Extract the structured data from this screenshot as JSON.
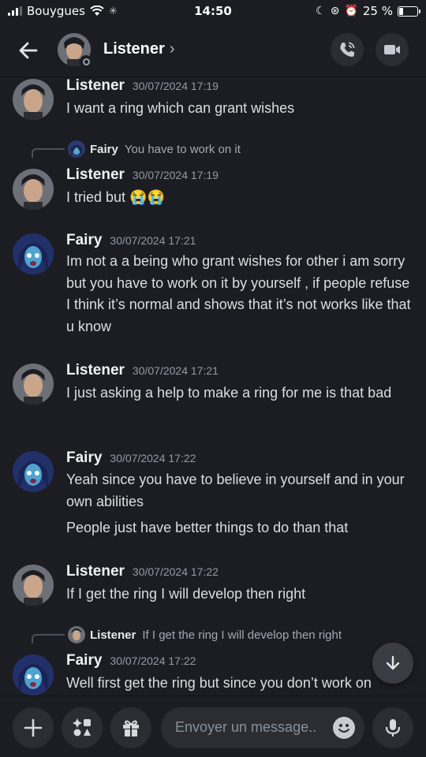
{
  "status_bar": {
    "carrier": "Bouygues",
    "time": "14:50",
    "battery_text": "25 %",
    "battery_level": 0.25
  },
  "header": {
    "title": "Listener",
    "chevron": "›",
    "icons": {
      "back": "arrow-left-icon",
      "call": "phone-call-icon",
      "video": "video-camera-icon"
    }
  },
  "messages": [
    {
      "author": "Listener",
      "timestamp": "30/07/2024 17:19",
      "lines": [
        "I want a ring which can grant wishes"
      ]
    },
    {
      "reply": {
        "author": "Fairy",
        "text": "You have to work on it"
      },
      "author": "Listener",
      "timestamp": "30/07/2024 17:19",
      "lines": [
        "I tried but 😭😭"
      ]
    },
    {
      "author": "Fairy",
      "timestamp": "30/07/2024 17:21",
      "lines": [
        "Im not a a being who grant wishes for other i am sorry but you have to work on it by yourself , if people refuse I think it’s normal and shows that it’s not works like that u know"
      ]
    },
    {
      "author": "Listener",
      "timestamp": "30/07/2024 17:21",
      "lines": [
        "I just asking a help to make a ring for me is that bad"
      ]
    },
    {
      "author": "Fairy",
      "timestamp": "30/07/2024 17:22",
      "lines": [
        "Yeah since you have to believe in yourself and in your own abilities",
        "People just have better things to do than that"
      ]
    },
    {
      "author": "Listener",
      "timestamp": "30/07/2024 17:22",
      "lines": [
        "If I get the ring I will develop then right"
      ]
    },
    {
      "reply": {
        "author": "Listener",
        "text": "If I get the ring I will develop then right"
      },
      "author": "Fairy",
      "timestamp": "30/07/2024 17:22",
      "lines": [
        "Well first get the ring but since you don’t work on"
      ]
    }
  ],
  "composer": {
    "placeholder": "Envoyer un message..",
    "icons": {
      "add": "plus-icon",
      "apps": "apps-icon",
      "gift": "gift-icon",
      "emoji": "emoji-icon",
      "mic": "microphone-icon",
      "scroll": "arrow-down-icon"
    }
  },
  "colors": {
    "background": "#1c1d22",
    "surface": "#2b2d33",
    "text": "#dbdee1",
    "muted": "#949ba4"
  }
}
